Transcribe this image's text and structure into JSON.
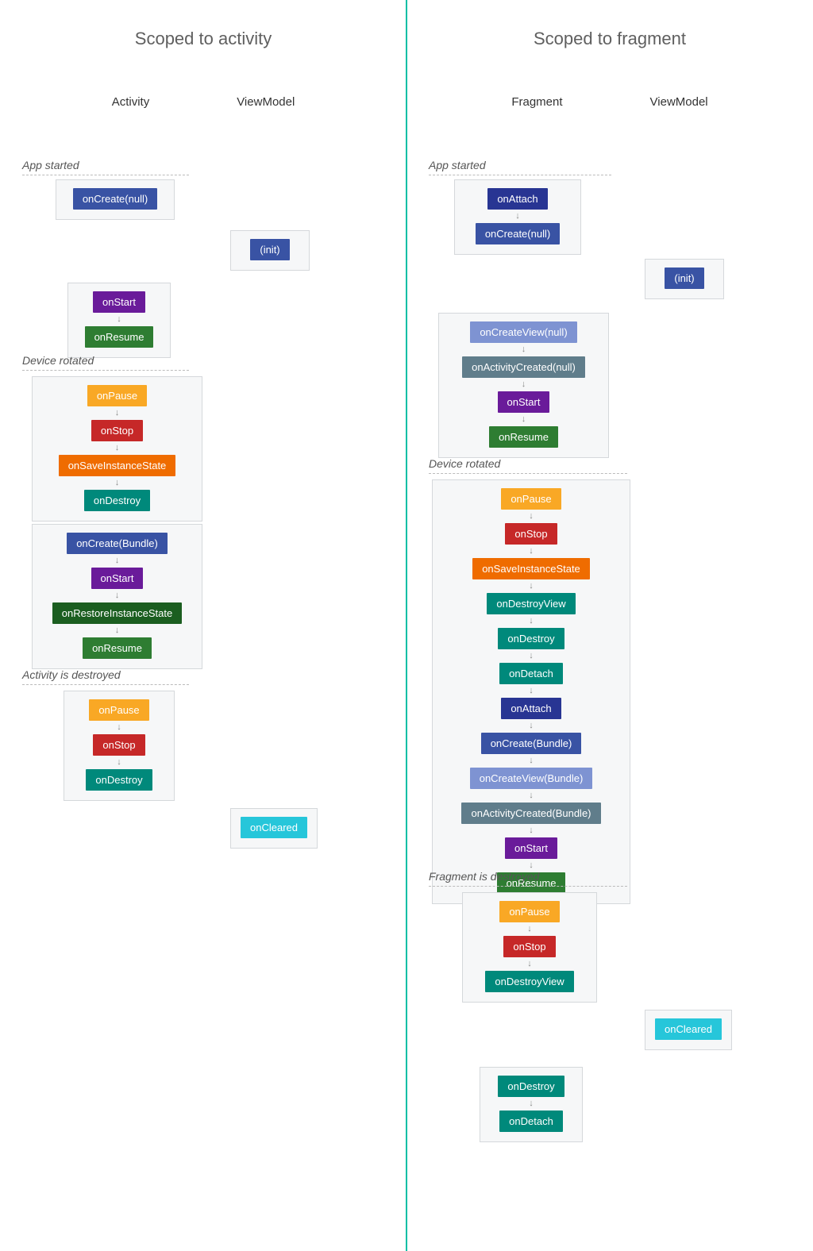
{
  "left": {
    "title": "Scoped to activity",
    "lane1": "Activity",
    "lane2": "ViewModel",
    "events": {
      "e1": "App started",
      "e2": "Device rotated",
      "e3": "Activity is destroyed"
    },
    "groups": {
      "g1": {
        "items": [
          "onCreate(null)"
        ]
      },
      "g2": {
        "items": [
          "(init)"
        ]
      },
      "g3": {
        "items": [
          "onStart",
          "onResume"
        ]
      },
      "g4": {
        "items": [
          "onPause",
          "onStop",
          "onSaveInstanceState",
          "onDestroy"
        ]
      },
      "g5": {
        "items": [
          "onCreate(Bundle)",
          "onStart",
          "onRestoreInstanceState",
          "onResume"
        ]
      },
      "g6": {
        "items": [
          "onPause",
          "onStop",
          "onDestroy"
        ]
      },
      "g7": {
        "items": [
          "onCleared"
        ]
      }
    }
  },
  "right": {
    "title": "Scoped to fragment",
    "lane1": "Fragment",
    "lane2": "ViewModel",
    "events": {
      "e1": "App started",
      "e2": "Device rotated",
      "e3": "Fragment is destroyed"
    },
    "groups": {
      "g1": {
        "items": [
          "onAttach",
          "onCreate(null)"
        ]
      },
      "g2": {
        "items": [
          "(init)"
        ]
      },
      "g3": {
        "items": [
          "onCreateView(null)",
          "onActivityCreated(null)",
          "onStart",
          "onResume"
        ]
      },
      "g4": {
        "items": [
          "onPause",
          "onStop",
          "onSaveInstanceState",
          "onDestroyView",
          "onDestroy",
          "onDetach",
          "onAttach",
          "onCreate(Bundle)",
          "onCreateView(Bundle)",
          "onActivityCreated(Bundle)",
          "onStart",
          "onResume"
        ]
      },
      "g5": {
        "items": [
          "onPause",
          "onStop",
          "onDestroyView"
        ]
      },
      "g6": {
        "items": [
          "onCleared"
        ]
      },
      "g7": {
        "items": [
          "onDestroy",
          "onDetach"
        ]
      }
    }
  },
  "colors": {
    "onCreate(null)": "c-blue",
    "onCreate(Bundle)": "c-blue",
    "(init)": "c-blue",
    "onAttach": "c-indigo",
    "onStart": "c-purple",
    "onResume": "c-green",
    "onRestoreInstanceState": "c-dgreen",
    "onPause": "c-amber",
    "onStop": "c-red",
    "onSaveInstanceState": "c-orange",
    "onDestroy": "c-teal",
    "onDestroyView": "c-teal",
    "onDetach": "c-teal",
    "onCleared": "c-cyan",
    "onCreateView(null)": "c-lblue",
    "onCreateView(Bundle)": "c-lblue",
    "onActivityCreated(null)": "c-slate",
    "onActivityCreated(Bundle)": "c-slate"
  }
}
